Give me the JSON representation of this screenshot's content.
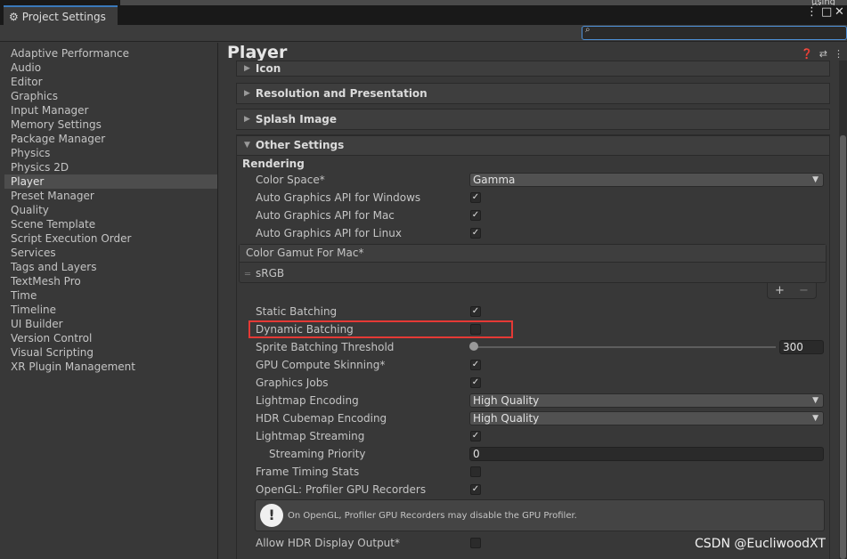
{
  "window": {
    "tab_title": "Project Settings",
    "corner_text": "using Ol"
  },
  "search": {
    "placeholder": ""
  },
  "sidebar": {
    "items": [
      "Adaptive Performance",
      "Audio",
      "Editor",
      "Graphics",
      "Input Manager",
      "Memory Settings",
      "Package Manager",
      "Physics",
      "Physics 2D",
      "Player",
      "Preset Manager",
      "Quality",
      "Scene Template",
      "Script Execution Order",
      "Services",
      "Tags and Layers",
      "TextMesh Pro",
      "Time",
      "Timeline",
      "UI Builder",
      "Version Control",
      "Visual Scripting",
      "XR Plugin Management"
    ],
    "selected": "Player"
  },
  "main": {
    "title": "Player",
    "foldouts": {
      "icon": "Icon",
      "resolution": "Resolution and Presentation",
      "splash": "Splash Image",
      "other": "Other Settings"
    },
    "rendering_header": "Rendering",
    "color_space": {
      "label": "Color Space*",
      "value": "Gamma"
    },
    "auto_windows": {
      "label": "Auto Graphics API  for Windows",
      "checked": true
    },
    "auto_mac": {
      "label": "Auto Graphics API  for Mac",
      "checked": true
    },
    "auto_linux": {
      "label": "Auto Graphics API  for Linux",
      "checked": true
    },
    "color_gamut": {
      "header": "Color Gamut For Mac*",
      "item": "sRGB",
      "add": "+",
      "remove": "−"
    },
    "static_batching": {
      "label": "Static Batching",
      "checked": true
    },
    "dynamic_batching": {
      "label": "Dynamic Batching",
      "checked": false
    },
    "sprite_threshold": {
      "label": "Sprite Batching Threshold",
      "value": "300"
    },
    "gpu_skinning": {
      "label": "GPU Compute Skinning*",
      "checked": true
    },
    "graphics_jobs": {
      "label": "Graphics Jobs",
      "checked": true
    },
    "lightmap_encoding": {
      "label": "Lightmap Encoding",
      "value": "High Quality"
    },
    "hdr_cubemap": {
      "label": "HDR Cubemap Encoding",
      "value": "High Quality"
    },
    "lightmap_streaming": {
      "label": "Lightmap Streaming",
      "checked": true
    },
    "streaming_priority": {
      "label": "Streaming Priority",
      "value": "0"
    },
    "frame_timing": {
      "label": "Frame Timing Stats",
      "checked": false
    },
    "opengl_profiler": {
      "label": "OpenGL: Profiler GPU Recorders",
      "checked": true
    },
    "help_message": "On OpenGL, Profiler GPU Recorders may disable the GPU Profiler.",
    "allow_hdr": {
      "label": "Allow HDR Display Output*",
      "checked": false
    }
  },
  "icons": {
    "gear": "gear-icon",
    "search": "search-icon",
    "help": "help-icon",
    "settings": "sliders-icon",
    "menu": "kebab-menu-icon"
  },
  "watermark": "CSDN @EucliwoodXT",
  "colors": {
    "highlight": "#e53935",
    "accent": "#3a79bb"
  }
}
